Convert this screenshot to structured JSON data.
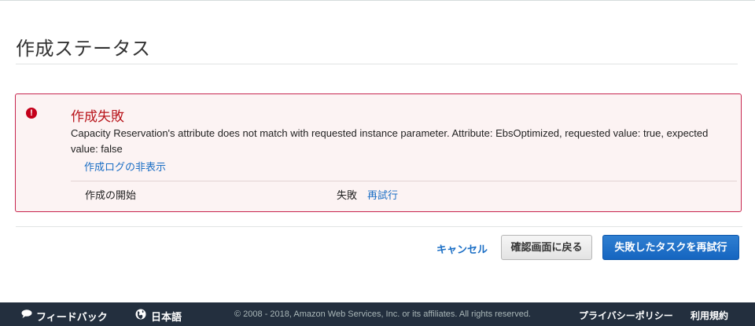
{
  "page": {
    "title": "作成ステータス"
  },
  "error": {
    "icon": "exclamation-circle-icon",
    "title": "作成失敗",
    "message": "Capacity Reservation's attribute does not match with requested instance parameter. Attribute: EbsOptimized, requested value: true, expected value: false",
    "hide_log_link": "作成ログの非表示",
    "steps": [
      {
        "label": "作成の開始",
        "status": "失敗",
        "retry_link": "再試行"
      }
    ]
  },
  "actions": {
    "cancel_label": "キャンセル",
    "back_label": "確認画面に戻る",
    "retry_failed_label": "失敗したタスクを再試行"
  },
  "footer": {
    "feedback_label": "フィードバック",
    "language_label": "日本語",
    "copyright": "© 2008 - 2018, Amazon Web Services, Inc. or its affiliates. All rights reserved.",
    "privacy_label": "プライバシーポリシー",
    "terms_label": "利用規約"
  },
  "colors": {
    "error_red": "#c4001a",
    "link_blue": "#1a6ec5",
    "primary_button": "#1565c0",
    "footer_bg": "#232f3e"
  }
}
